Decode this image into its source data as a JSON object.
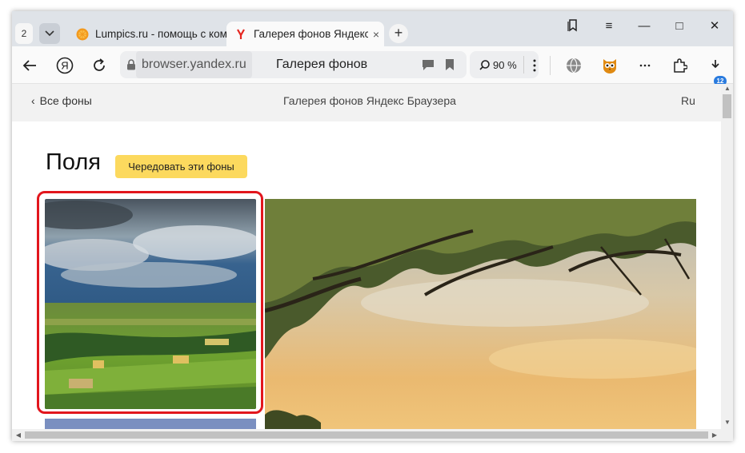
{
  "tabstrip": {
    "tab_count": "2",
    "tabs": [
      {
        "title": "Lumpics.ru - помощь с ком",
        "active": false
      },
      {
        "title": "Галерея фонов Яндекс",
        "active": true
      }
    ],
    "close_glyph": "×",
    "new_tab_glyph": "+",
    "window_buttons": {
      "collections": "collections-icon",
      "menu": "≡",
      "minimize": "—",
      "maximize": "□",
      "close": "✕"
    }
  },
  "toolbar": {
    "address_domain": "browser.yandex.ru",
    "address_title": "Галерея фонов",
    "zoom_label": "90 %",
    "downloads_badge": "12",
    "icons": [
      "back-arrow-icon",
      "yandex-logo-icon",
      "reload-icon",
      "lock-icon",
      "comment-icon",
      "bookmark-icon",
      "magnifier-icon",
      "more-vertical-icon",
      "globe-icon",
      "owl-extension-icon",
      "more-horizontal-icon",
      "extensions-icon",
      "downloads-icon"
    ]
  },
  "page": {
    "back_label": "Все фоны",
    "header_title": "Галерея фонов Яндекс Браузера",
    "language": "Ru",
    "section_title": "Поля",
    "rotate_button": "Чередовать эти фоны"
  },
  "colors": {
    "accent_button": "#fcd95e",
    "highlight": "#e2161d",
    "tabstrip": "#dfe3e8"
  }
}
